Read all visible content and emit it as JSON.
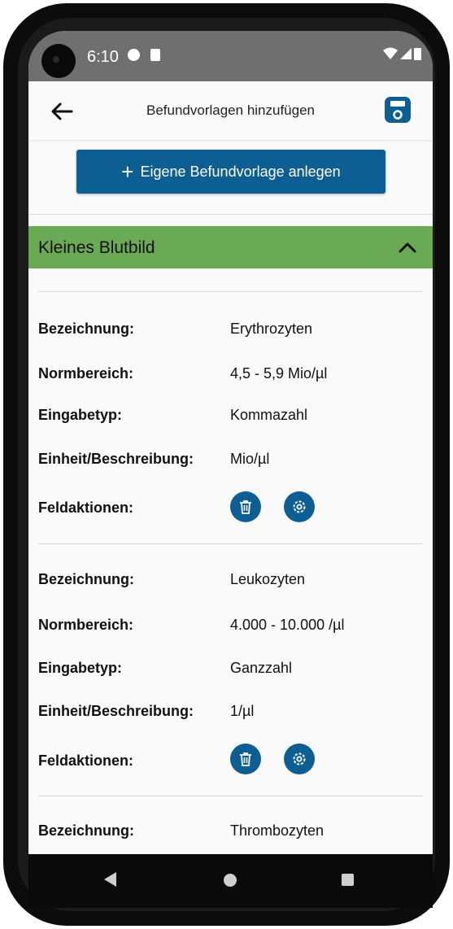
{
  "status_bar": {
    "time": "6:10"
  },
  "header": {
    "title": "Befundvorlagen hinzufügen"
  },
  "actions": {
    "add_template": "Eigene Befundvorlage anlegen"
  },
  "section": {
    "title": "Kleines Blutbild"
  },
  "labels": {
    "name": "Bezeichnung:",
    "range": "Normbereich:",
    "input_type": "Eingabetyp:",
    "unit": "Einheit/Beschreibung:",
    "field_actions": "Feldaktionen:"
  },
  "fields": [
    {
      "name": "Erythrozyten",
      "range": "4,5 - 5,9 Mio/µl",
      "input_type": "Kommazahl",
      "unit": "Mio/µl"
    },
    {
      "name": "Leukozyten",
      "range": "4.000 - 10.000 /µl",
      "input_type": "Ganzzahl",
      "unit": "1/µl"
    },
    {
      "name": "Thrombozyten"
    }
  ],
  "colors": {
    "primary": "#0d5f93",
    "section_bg": "#6aaa55",
    "statusbar": "#6f6f6f"
  },
  "icons": [
    "back-arrow-icon",
    "save-icon",
    "plus-icon",
    "chevron-up-icon",
    "trash-icon",
    "gear-icon"
  ]
}
